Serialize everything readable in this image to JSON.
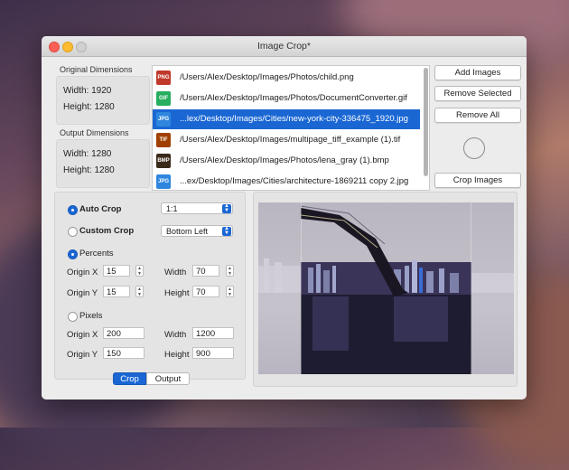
{
  "window": {
    "title": "Image Crop*"
  },
  "original_dimensions": {
    "label": "Original Dimensions",
    "width": "Width: 1920",
    "height": "Height: 1280"
  },
  "output_dimensions": {
    "label": "Output Dimensions",
    "width": "Width: 1280",
    "height": "Height: 1280"
  },
  "files": [
    {
      "type": "PNG",
      "color": "#c0392b",
      "path": "/Users/Alex/Desktop/Images/Photos/child.png",
      "selected": false
    },
    {
      "type": "GIF",
      "color": "#27ae60",
      "path": "/Users/Alex/Desktop/Images/Photos/DocumentConverter.gif",
      "selected": false
    },
    {
      "type": "JPG",
      "color": "#2e86de",
      "path": "...lex/Desktop/Images/Cities/new-york-city-336475_1920.jpg",
      "selected": true
    },
    {
      "type": "TIF",
      "color": "#a04000",
      "path": "/Users/Alex/Desktop/Images/multipage_tiff_example (1).tif",
      "selected": false
    },
    {
      "type": "BMP",
      "color": "#3a2a1a",
      "path": "/Users/Alex/Desktop/Images/Photos/lena_gray (1).bmp",
      "selected": false
    },
    {
      "type": "JPG",
      "color": "#2e86de",
      "path": "...ex/Desktop/Images/Cities/architecture-1869211 copy 2.jpg",
      "selected": false
    }
  ],
  "buttons": {
    "add_images": "Add Images",
    "remove_selected": "Remove Selected",
    "remove_all": "Remove All",
    "crop_images": "Crop Images"
  },
  "crop": {
    "auto_crop_label": "Auto Crop",
    "auto_crop_value": "1:1",
    "custom_crop_label": "Custom Crop",
    "custom_crop_value": "Bottom Left",
    "percents_label": "Percents",
    "pixels_label": "Pixels",
    "origin_x_label": "Origin X",
    "origin_y_label": "Origin Y",
    "width_label": "Width",
    "height_label": "Height",
    "percents": {
      "origin_x": "15",
      "origin_y": "15",
      "width": "70",
      "height": "70"
    },
    "pixels": {
      "origin_x": "200",
      "origin_y": "150",
      "width": "1200",
      "height": "900"
    }
  },
  "tabs": {
    "crop": "Crop",
    "output": "Output"
  },
  "colors": {
    "accent": "#1a67d4"
  },
  "icons": {
    "up_down": "chevron-up-down-icon"
  }
}
